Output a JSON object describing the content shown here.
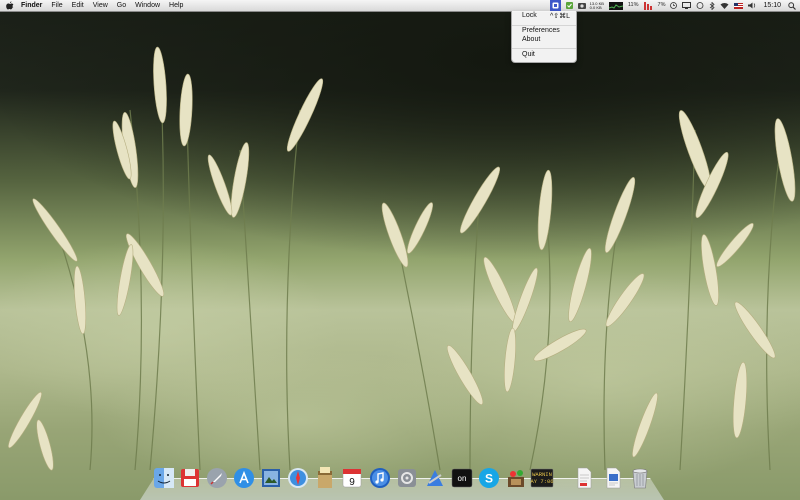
{
  "menubar": {
    "app_name": "Finder",
    "menus": [
      "File",
      "Edit",
      "View",
      "Go",
      "Window",
      "Help"
    ],
    "icons": [
      "apple-icon",
      "app-extra-icon",
      "green-extra-icon",
      "cpu-monitor-icon",
      "memory-stats-icon",
      "battery-icon",
      "wifi-icon",
      "volume-icon",
      "spotlight-icon"
    ],
    "stats_line1": "13.0 KB",
    "stats_line2": "0.0 KB",
    "battery_percent_1": "11%",
    "battery_percent_2": "7%",
    "clock": "15:10"
  },
  "dropdown": {
    "lock_label": "Lock",
    "lock_shortcut": "^⇧⌘L",
    "preferences_label": "Preferences",
    "about_label": "About",
    "quit_label": "Quit"
  },
  "dock": {
    "icons": [
      "finder-icon",
      "floppy-icon",
      "rocket-icon",
      "app-store-icon",
      "preview-icon",
      "safari-icon",
      "notes-icon",
      "calendar-icon",
      "itunes-icon",
      "system-preferences-icon",
      "xcode-icon",
      "terminal-icon",
      "skype-icon",
      "activity-icon",
      "console-icon",
      "document-icon",
      "document2-icon",
      "trash-icon"
    ],
    "calendar_day": "9",
    "terminal_text": "on",
    "console_text_1": "WARNIN",
    "console_text_2": "AY 7:06"
  },
  "colors": {
    "menubar_highlight": "#3e57c9",
    "sky_dark": "#1a1f17",
    "grass_light": "#b9c39a"
  }
}
